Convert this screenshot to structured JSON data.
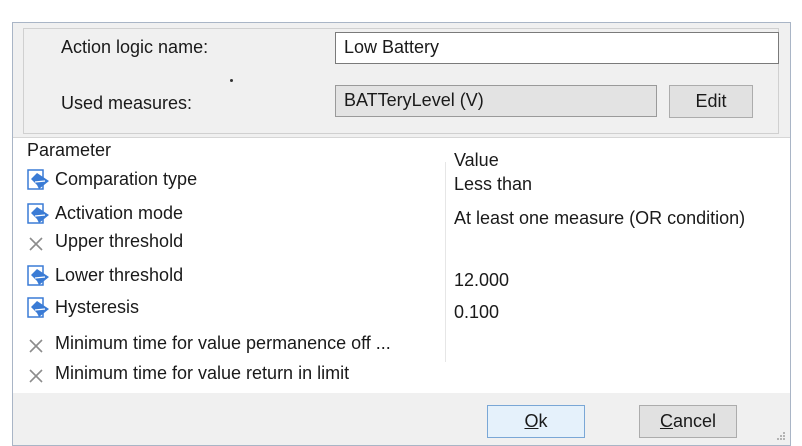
{
  "form": {
    "action_logic_name_label": "Action logic name:",
    "action_logic_name_value": "Low Battery",
    "used_measures_label": "Used measures:",
    "used_measures_value": "BATTeryLevel (V)",
    "edit_label": "Edit"
  },
  "grid": {
    "col_parameter": "Parameter",
    "col_value": "Value",
    "rows": [
      {
        "name": "Comparation type",
        "value": "Less than",
        "icon": "edit-icon"
      },
      {
        "name": "Activation mode",
        "value": "At least one measure (OR condition)",
        "icon": "edit-icon"
      },
      {
        "name": "Upper threshold",
        "value": "",
        "icon": "disabled-x-icon"
      },
      {
        "name": "Lower threshold",
        "value": "12.000",
        "icon": "edit-icon"
      },
      {
        "name": "Hysteresis",
        "value": "0.100",
        "icon": "edit-icon"
      },
      {
        "name": "Minimum time for value permanence off ...",
        "value": "",
        "icon": "disabled-x-icon"
      },
      {
        "name": "Minimum time for value return in limit",
        "value": "",
        "icon": "disabled-x-icon"
      }
    ]
  },
  "footer": {
    "ok_accel": "O",
    "ok_rest": "k",
    "cancel_accel": "C",
    "cancel_rest": "ancel"
  },
  "colors": {
    "dialog_bg": "#f0f0f0",
    "grid_bg": "#ffffff",
    "icon_blue": "#3a7bd5",
    "x_gray": "#8c8c8c"
  }
}
